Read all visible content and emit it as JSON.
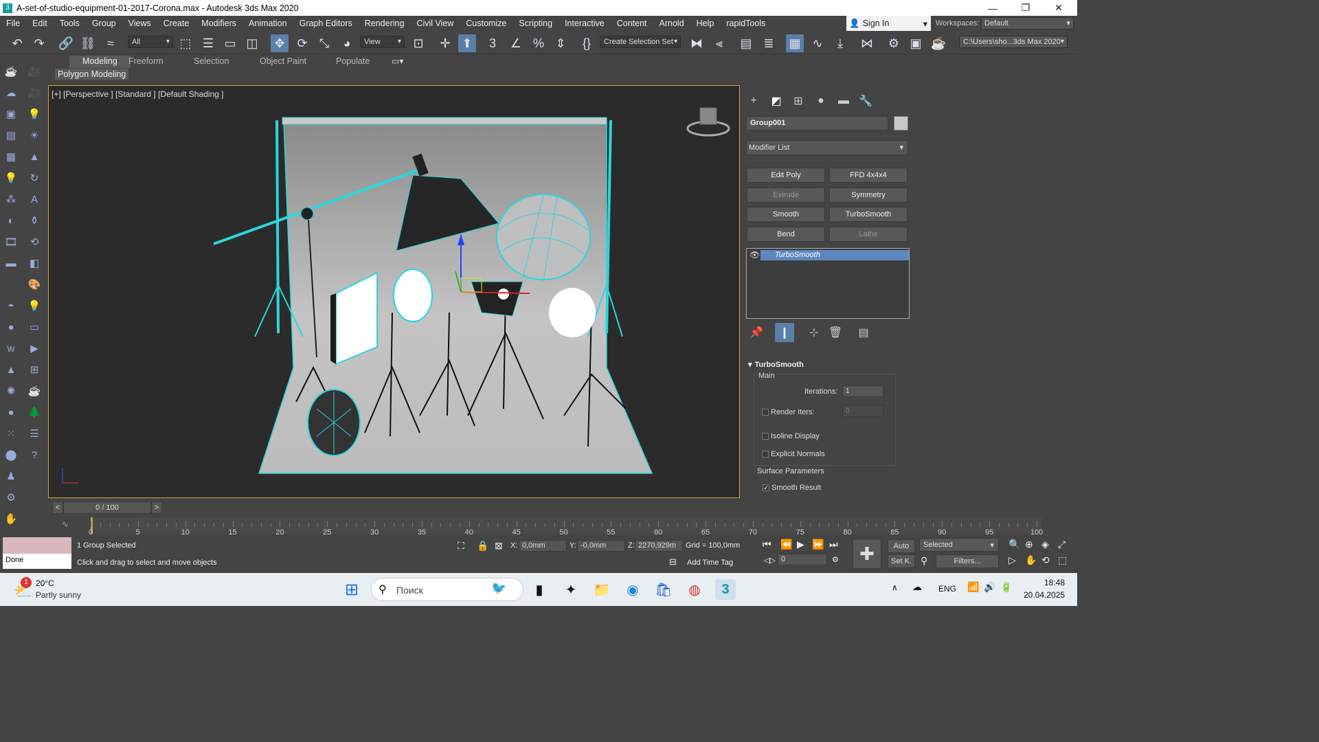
{
  "window": {
    "title": "A-set-of-studio-equipment-01-2017-Corona.max - Autodesk 3ds Max 2020",
    "app_icon": "3"
  },
  "menu": [
    "File",
    "Edit",
    "Tools",
    "Group",
    "Views",
    "Create",
    "Modifiers",
    "Animation",
    "Graph Editors",
    "Rendering",
    "Civil View",
    "Customize",
    "Scripting",
    "Interactive",
    "Content",
    "Arnold",
    "Help",
    "rapidTools"
  ],
  "signin": {
    "label": "Sign In"
  },
  "workspaces": {
    "label": "Workspaces:",
    "value": "Default"
  },
  "toolbar": {
    "filter": "All",
    "ref_coord": "View",
    "selection_set": "Create Selection Set",
    "project_path": "C:\\Users\\sho...3ds Max 2020"
  },
  "ribbon": {
    "tabs": [
      "Modeling",
      "Freeform",
      "Selection",
      "Object Paint",
      "Populate"
    ],
    "active_tab": "Modeling",
    "panel": "Polygon Modeling"
  },
  "viewport": {
    "label": "[+] [Perspective ] [Standard ] [Default Shading ]",
    "selection_color": "#2ad6e0"
  },
  "command_panel": {
    "object_name": "Group001",
    "modifier_list": "Modifier List",
    "modifier_buttons": [
      [
        "Edit Poly",
        "FFD 4x4x4"
      ],
      [
        "Extrude",
        "Symmetry"
      ],
      [
        "Smooth",
        "TurboSmooth"
      ],
      [
        "Bend",
        "Lathe"
      ]
    ],
    "stack": [
      "TurboSmooth"
    ],
    "rollout": {
      "title": "TurboSmooth",
      "main_label": "Main",
      "iterations_label": "Iterations:",
      "iterations": "1",
      "render_iters_label": "Render Iters:",
      "render_iters": "0",
      "isoline": "Isoline Display",
      "explicit": "Explicit Normals",
      "surface": "Surface Parameters",
      "smooth_result": "Smooth Result"
    }
  },
  "timeline": {
    "frame": "0 / 100",
    "ticks": [
      "0",
      "5",
      "10",
      "15",
      "20",
      "25",
      "30",
      "35",
      "40",
      "45",
      "50",
      "55",
      "60",
      "65",
      "70",
      "75",
      "80",
      "85",
      "90",
      "95",
      "100"
    ]
  },
  "status": {
    "maxscript_output": "Done",
    "selection": "1 Group Selected",
    "prompt": "Click and drag to select and move objects",
    "x_label": "X:",
    "x": "0,0mm",
    "y_label": "Y:",
    "y": "-0,0mm",
    "z_label": "Z:",
    "z": "2270,929m",
    "grid": "Grid = 100,0mm",
    "add_time_tag": "Add Time Tag",
    "auto": "Auto",
    "setk": "Set K.",
    "selected": "Selected",
    "filters": "Filters...",
    "frame_input": "0"
  },
  "taskbar": {
    "weather_temp": "20°C",
    "weather_desc": "Partly sunny",
    "weather_badge": "1",
    "search": "Поиск",
    "lang": "ENG",
    "time": "18:48",
    "date": "20.04.2025"
  }
}
